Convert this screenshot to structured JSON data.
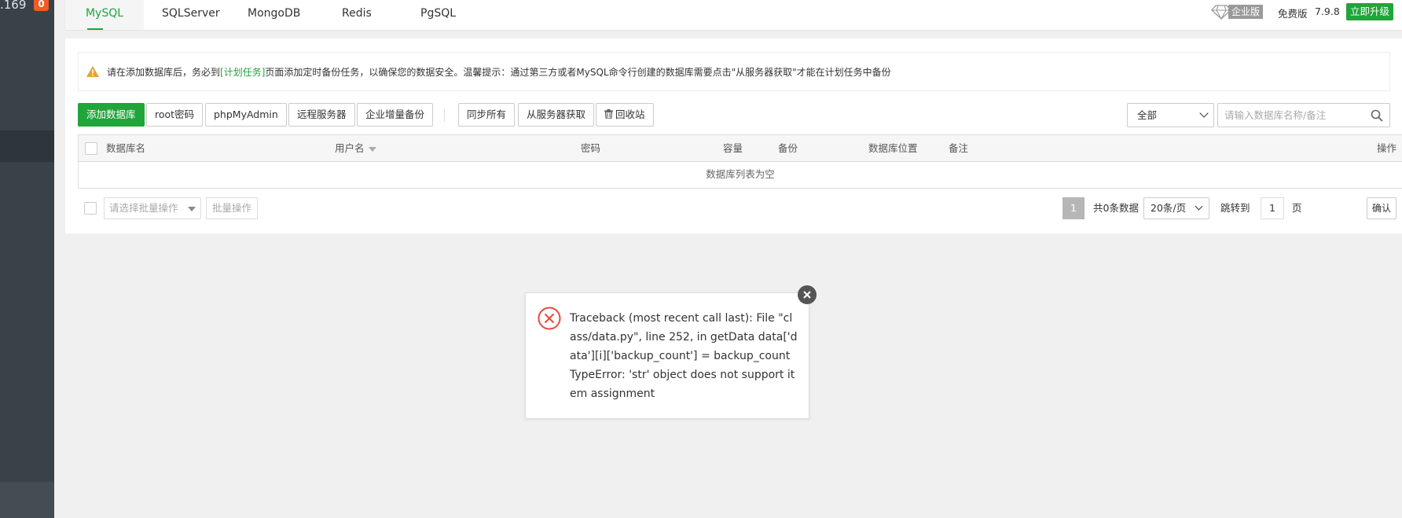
{
  "sidebar": {
    "ip_fragment": ".169",
    "badge_count": "0"
  },
  "tabs": [
    {
      "label": "MySQL",
      "active": true
    },
    {
      "label": "SQLServer"
    },
    {
      "label": "MongoDB"
    },
    {
      "label": "Redis"
    },
    {
      "label": "PgSQL"
    }
  ],
  "header": {
    "enterprise_label": "企业版",
    "free_label": "免费版",
    "version": "7.9.8",
    "upgrade_label": "立即升级"
  },
  "notice": {
    "prefix": "请在添加数据库后，务必到",
    "link": "[计划任务]",
    "suffix": "页面添加定时备份任务，以确保您的数据安全。温馨提示：通过第三方或者MySQL命令行创建的数据库需要点击\"从服务器获取\"才能在计划任务中备份"
  },
  "toolbar": {
    "add_db": "添加数据库",
    "root_pwd": "root密码",
    "phpmyadmin": "phpMyAdmin",
    "remote_server": "远程服务器",
    "enterprise_backup": "企业增量备份",
    "sync_all": "同步所有",
    "fetch_from_server": "从服务器获取",
    "recycle_bin": "回收站"
  },
  "filter": {
    "selected": "全部",
    "search_placeholder": "请输入数据库名称/备注"
  },
  "table": {
    "headers": {
      "name": "数据库名",
      "user": "用户名",
      "password": "密码",
      "size": "容量",
      "backup": "备份",
      "location": "数据库位置",
      "note": "备注",
      "action": "操作"
    },
    "empty_text": "数据库列表为空"
  },
  "batch": {
    "select_placeholder": "请选择批量操作",
    "button": "批量操作"
  },
  "pager": {
    "current": "1",
    "total_text": "共0条数据",
    "page_size": "20条/页",
    "jump_label": "跳转到",
    "jump_value": "1",
    "page_unit": "页",
    "confirm": "确认"
  },
  "error_dialog": {
    "message": "Traceback (most recent call last): File \"class/data.py\", line 252, in getData data['data'][i]['backup_count'] = backup_count TypeError: 'str' object does not support item assignment"
  },
  "colors": {
    "accent": "#20a53a",
    "sidebar_bg": "#394249",
    "badge": "#f05a24",
    "warning": "#e6a23c",
    "error": "#e64b3c"
  }
}
